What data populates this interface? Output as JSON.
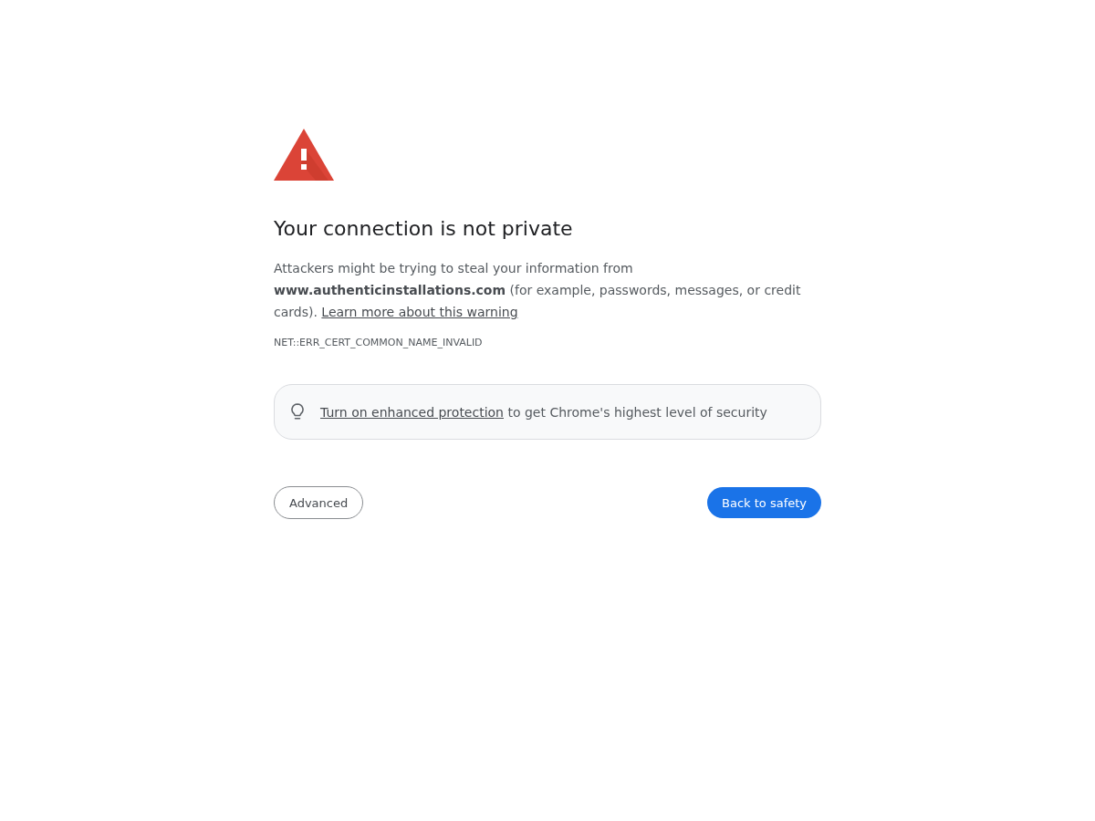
{
  "heading": "Your connection is not private",
  "message": {
    "text": "Attackers might be trying to steal your information from **www.authenticinstallations.com** (for example, passwords, messages, or credit cards).",
    "link": "Learn more about this warning"
  },
  "error_code": "NET::ERR_CERT_COMMON_NAME_INVALID",
  "protection_banner": {
    "link": "Turn on enhanced protection",
    "text": "to get Chrome's highest level of security"
  },
  "buttons": [
    {
      "label": "Advanced",
      "kind": "secondary"
    },
    {
      "label": "Back to safety",
      "kind": "primary"
    }
  ]
}
